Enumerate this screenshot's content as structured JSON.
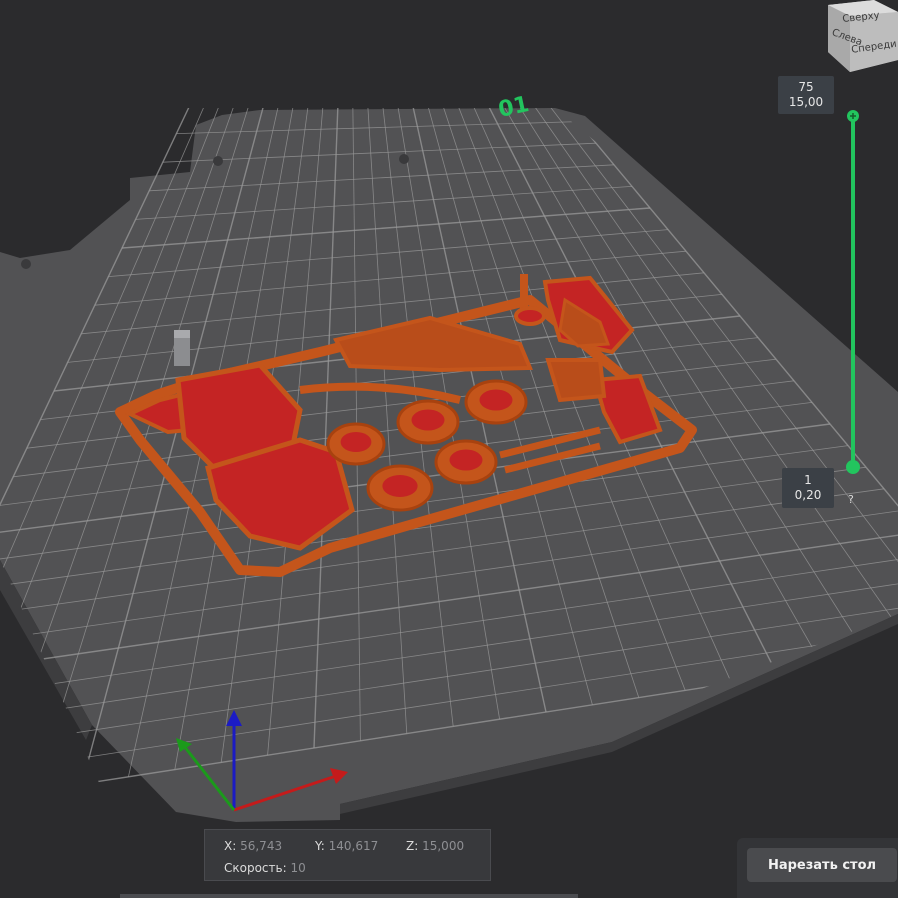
{
  "plate": {
    "number": "01"
  },
  "view_cube": {
    "top_label": "Сверху",
    "left_label": "Слева",
    "front_label": "Спереди"
  },
  "layer_slider": {
    "top": {
      "layer": "75",
      "height": "15,00"
    },
    "bottom": {
      "layer": "1",
      "height": "0,20"
    },
    "help_label": "?",
    "color": "#22c55e"
  },
  "position_readout": {
    "x_label": "X:",
    "x_value": "56,743",
    "y_label": "Y:",
    "y_value": "140,617",
    "z_label": "Z:",
    "z_value": "15,000",
    "speed_label": "Скорость:",
    "speed_value": "10"
  },
  "slice_button": {
    "label": "Нарезать стол"
  },
  "colors": {
    "model": "#c4551b",
    "model_inner": "#c42424",
    "grid": "#9a9a9a",
    "plate_bg": "#525254"
  }
}
